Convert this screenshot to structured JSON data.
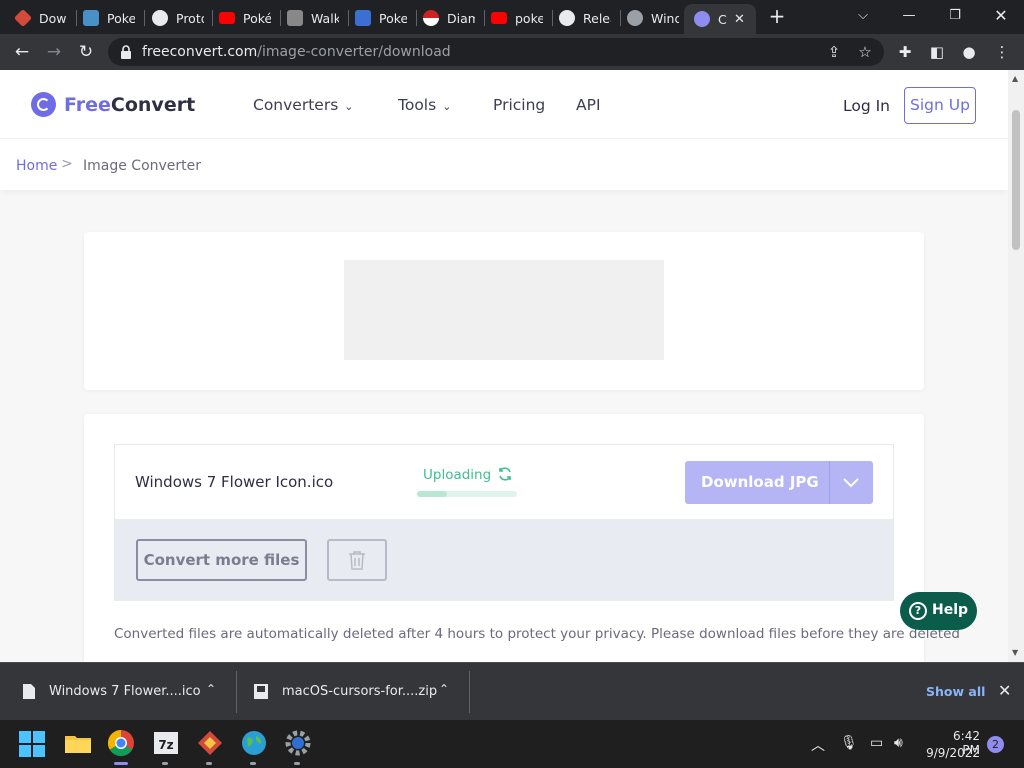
{
  "browser": {
    "tabs": [
      {
        "label": "Dow",
        "color": "#d44a3a"
      },
      {
        "label": "Poke",
        "color": "#4a90c8"
      },
      {
        "label": "Proto",
        "color": "#e8eaed"
      },
      {
        "label": "Poké",
        "color": "#ff0000"
      },
      {
        "label": "Walk",
        "color": "#888888"
      },
      {
        "label": "Poke",
        "color": "#3b6fd4"
      },
      {
        "label": "Diam",
        "color": "#cc2222"
      },
      {
        "label": "poke",
        "color": "#ff0000"
      },
      {
        "label": "Relea",
        "color": "#e8eaed"
      },
      {
        "label": "Wind",
        "color": "#9aa0a6"
      },
      {
        "label": "C",
        "color": "#8f8cf0"
      }
    ],
    "url_host": "freeconvert.com",
    "url_path": "/image-converter/download"
  },
  "site": {
    "logo_free": "Free",
    "logo_convert": "Convert",
    "nav": {
      "converters": "Converters",
      "tools": "Tools",
      "pricing": "Pricing",
      "api": "API"
    },
    "login": "Log In",
    "signup": "Sign Up"
  },
  "breadcrumb": {
    "home": "Home",
    "separator": ">",
    "current": "Image Converter"
  },
  "file": {
    "name": "Windows 7 Flower Icon.ico",
    "status": "Uploading",
    "progress": 0.3,
    "download_label": "Download JPG"
  },
  "actions": {
    "convert_more": "Convert more files"
  },
  "privacy_note": "Converted files are automatically deleted after 4 hours to protect your privacy. Please download files before they are deleted",
  "help": "Help",
  "downloads_shelf": {
    "items": [
      {
        "name": "Windows 7 Flower....ico"
      },
      {
        "name": "macOS-cursors-for....zip"
      }
    ],
    "show_all": "Show all"
  },
  "taskbar": {
    "time": "6:42 PM",
    "date": "9/9/2022",
    "notifications": "2"
  },
  "colors": {
    "brand": "#6f6ce5",
    "status_green": "#3fbf8f",
    "help_bg": "#0b5c4b"
  }
}
